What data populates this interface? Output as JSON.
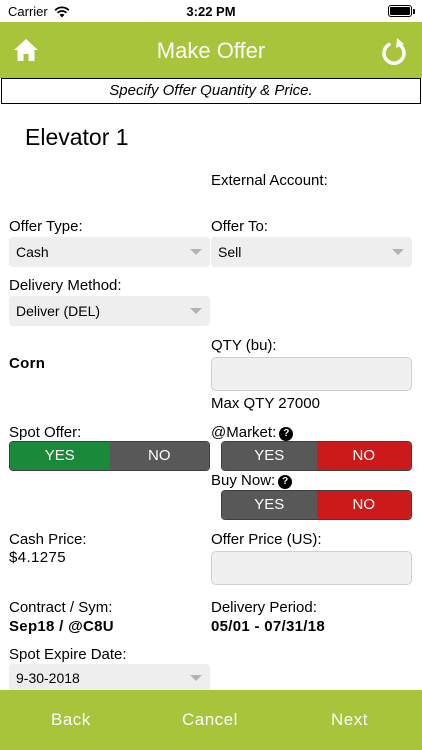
{
  "status": {
    "carrier": "Carrier",
    "time": "3:22 PM"
  },
  "header": {
    "title": "Make Offer",
    "home_icon": "home-icon",
    "refresh_icon": "refresh-icon"
  },
  "subtitle": "Specify Offer Quantity & Price.",
  "elevator": "Elevator 1",
  "external_account": {
    "label": "External Account:"
  },
  "offer_type": {
    "label": "Offer Type:",
    "value": "Cash"
  },
  "offer_to": {
    "label": "Offer To:",
    "value": "Sell"
  },
  "delivery_method": {
    "label": "Delivery Method:",
    "value": "Deliver (DEL)"
  },
  "commodity": "Corn",
  "qty": {
    "label": "QTY (bu):",
    "value": "",
    "max": "Max QTY 27000"
  },
  "spot_offer": {
    "label": "Spot Offer:",
    "yes": "YES",
    "no": "NO",
    "selected": "YES"
  },
  "at_market": {
    "label": "@Market:",
    "yes": "YES",
    "no": "NO",
    "selected": "NO"
  },
  "buy_now": {
    "label": "Buy Now:",
    "yes": "YES",
    "no": "NO",
    "selected": "NO"
  },
  "cash_price": {
    "label": "Cash Price:",
    "value": "$4.1275"
  },
  "offer_price": {
    "label": "Offer Price (US):",
    "value": ""
  },
  "contract": {
    "label": "Contract / Sym:",
    "value": "Sep18 / @C8U"
  },
  "delivery_period": {
    "label": "Delivery Period:",
    "value": "05/01 - 07/31/18"
  },
  "spot_expire": {
    "label": "Spot Expire Date:",
    "value": "9-30-2018"
  },
  "footer": {
    "back": "Back",
    "cancel": "Cancel",
    "next": "Next"
  },
  "colors": {
    "brand": "#a7c43a",
    "yes_active": "#1a8a3a",
    "no_active": "#cc1a1a",
    "inactive": "#585858"
  }
}
